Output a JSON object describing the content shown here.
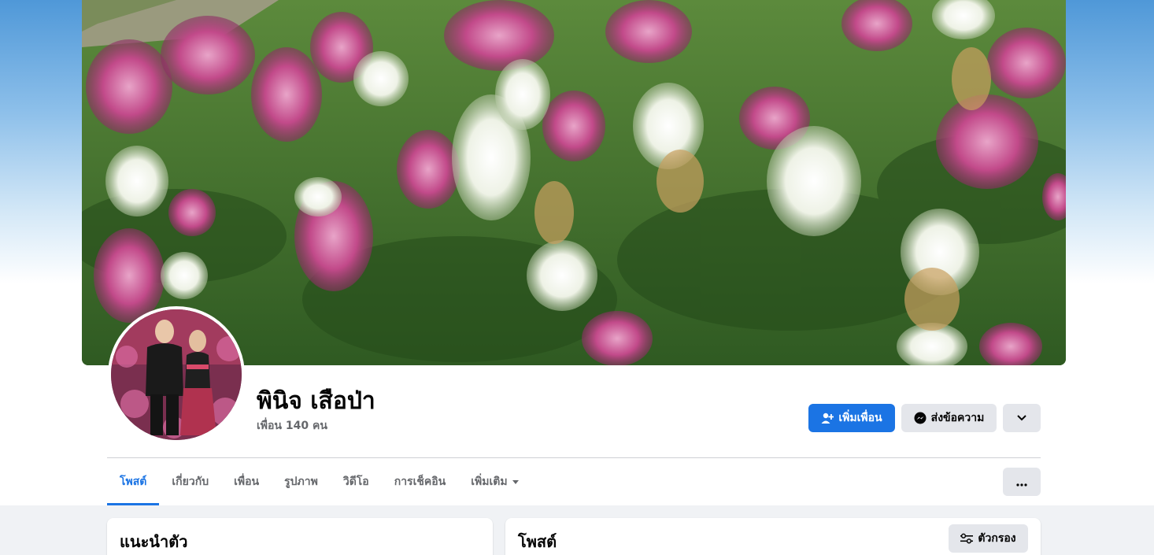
{
  "profile": {
    "name": "พินิจ เสือป่า",
    "friends_count": "เพื่อน 140 คน"
  },
  "actions": {
    "add_friend_label": "เพิ่มเพื่อน",
    "message_label": "ส่งข้อความ",
    "add_friend_icon": "person-add-icon",
    "message_icon": "messenger-icon",
    "more_icon": "chevron-down-icon"
  },
  "tabs": [
    {
      "label": "โพสต์",
      "active": true
    },
    {
      "label": "เกี่ยวกับ",
      "active": false
    },
    {
      "label": "เพื่อน",
      "active": false
    },
    {
      "label": "รูปภาพ",
      "active": false
    },
    {
      "label": "วิดีโอ",
      "active": false
    },
    {
      "label": "การเช็คอิน",
      "active": false
    },
    {
      "label": "เพิ่มเติม",
      "active": false
    }
  ],
  "intro_card": {
    "title": "แนะนำตัว"
  },
  "posts_card": {
    "title": "โพสต์",
    "filter_label": "ตัวกรอง"
  },
  "colors": {
    "accent": "#1b74e4",
    "secondary_button": "#e4e6eb",
    "page_background": "#f0f2f5"
  }
}
